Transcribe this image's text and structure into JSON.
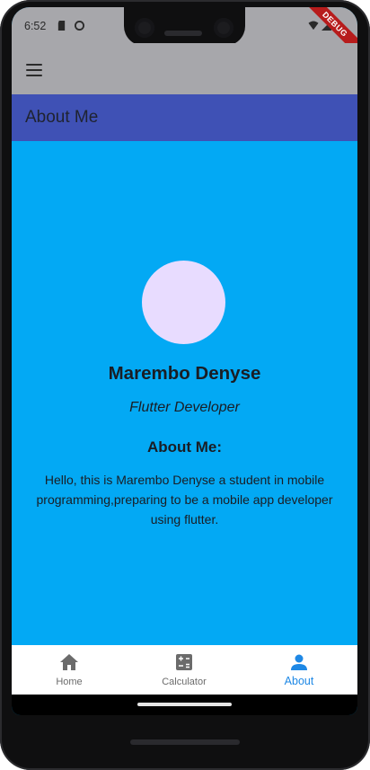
{
  "status_bar": {
    "time": "6:52"
  },
  "debug_banner": "DEBUG",
  "app_bar": {
    "title": "About Me"
  },
  "profile": {
    "name": "Marembo Denyse",
    "role": "Flutter Developer",
    "about_heading": "About Me:",
    "bio": "Hello, this is Marembo Denyse a student in mobile programming,preparing to be a mobile app developer using flutter."
  },
  "bottom_nav": [
    {
      "label": "Home",
      "icon": "home-icon",
      "active": false
    },
    {
      "label": "Calculator",
      "icon": "calculator-icon",
      "active": false
    },
    {
      "label": "About",
      "icon": "person-icon",
      "active": true
    }
  ],
  "colors": {
    "background": "#03a9f4",
    "title_bar": "#3f51b5",
    "avatar": "#e8dcff",
    "active_nav": "#1e88e5",
    "debug": "#b71c1c"
  }
}
